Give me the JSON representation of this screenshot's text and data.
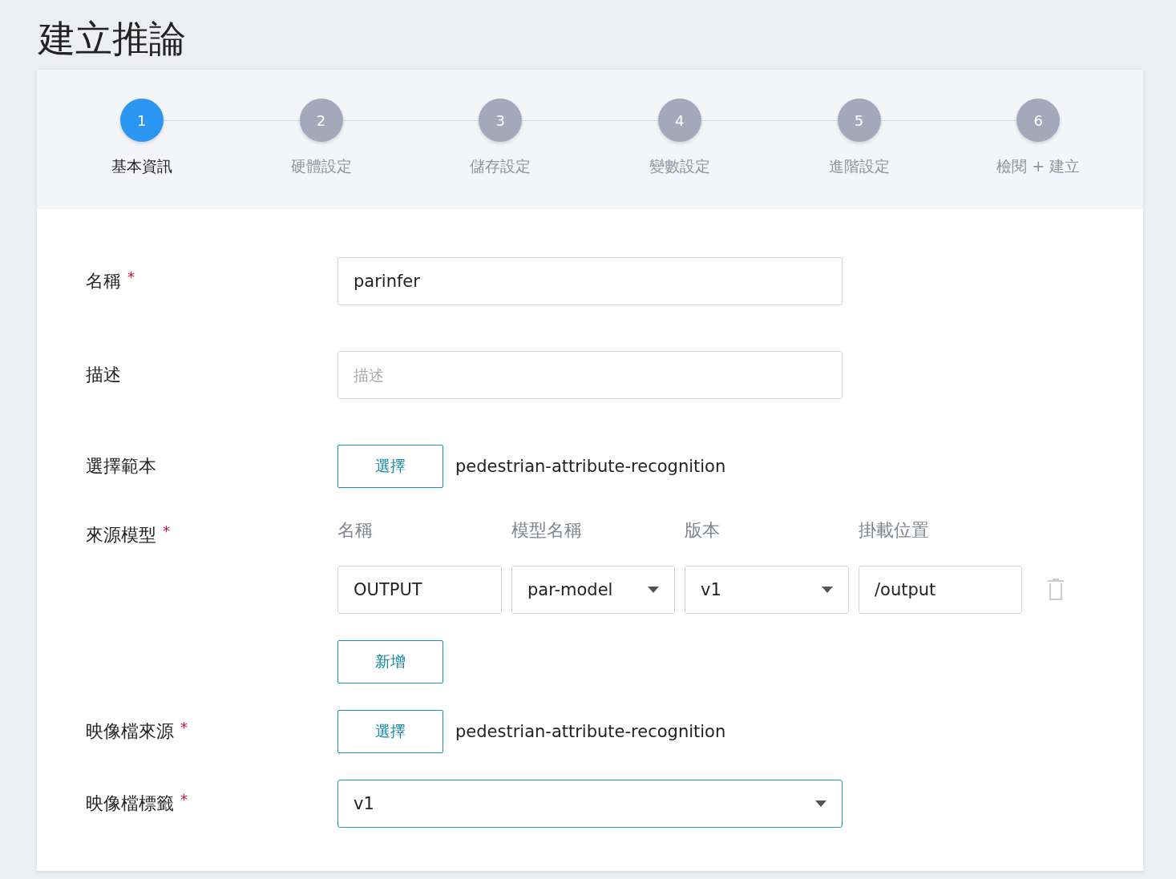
{
  "title": "建立推論",
  "steps": [
    {
      "number": "1",
      "label": "基本資訊",
      "selected": true
    },
    {
      "number": "2",
      "label": "硬體設定",
      "selected": false
    },
    {
      "number": "3",
      "label": "儲存設定",
      "selected": false
    },
    {
      "number": "4",
      "label": "變數設定",
      "selected": false
    },
    {
      "number": "5",
      "label": "進階設定",
      "selected": false
    },
    {
      "number": "6",
      "label": "檢閱 + 建立",
      "selected": false
    }
  ],
  "form": [
    {
      "kind": "text",
      "label": "名稱",
      "required_mark": "*",
      "value": "parinfer"
    },
    {
      "kind": "text",
      "label": "描述",
      "placeholder": "描述"
    },
    {
      "kind": "chooser",
      "label": "選擇範本",
      "button": "選擇",
      "value": "pedestrian-attribute-recognition"
    },
    {
      "kind": "models",
      "label": "來源模型",
      "required_mark": "*",
      "columns": [
        "名稱",
        "模型名稱",
        "版本",
        "掛載位置"
      ],
      "rows": [
        {
          "cells": [
            {
              "kind": "text",
              "value": "OUTPUT"
            },
            {
              "kind": "select",
              "value": "par-model"
            },
            {
              "kind": "select",
              "value": "v1"
            },
            {
              "kind": "text",
              "value": "/output"
            }
          ]
        }
      ],
      "add_button": "新增"
    },
    {
      "kind": "chooser",
      "label": "映像檔來源",
      "required_mark": "*",
      "button": "選擇",
      "value": "pedestrian-attribute-recognition"
    },
    {
      "kind": "select",
      "label": "映像檔標籤",
      "required_mark": "*",
      "value": "v1",
      "focused": true
    }
  ]
}
